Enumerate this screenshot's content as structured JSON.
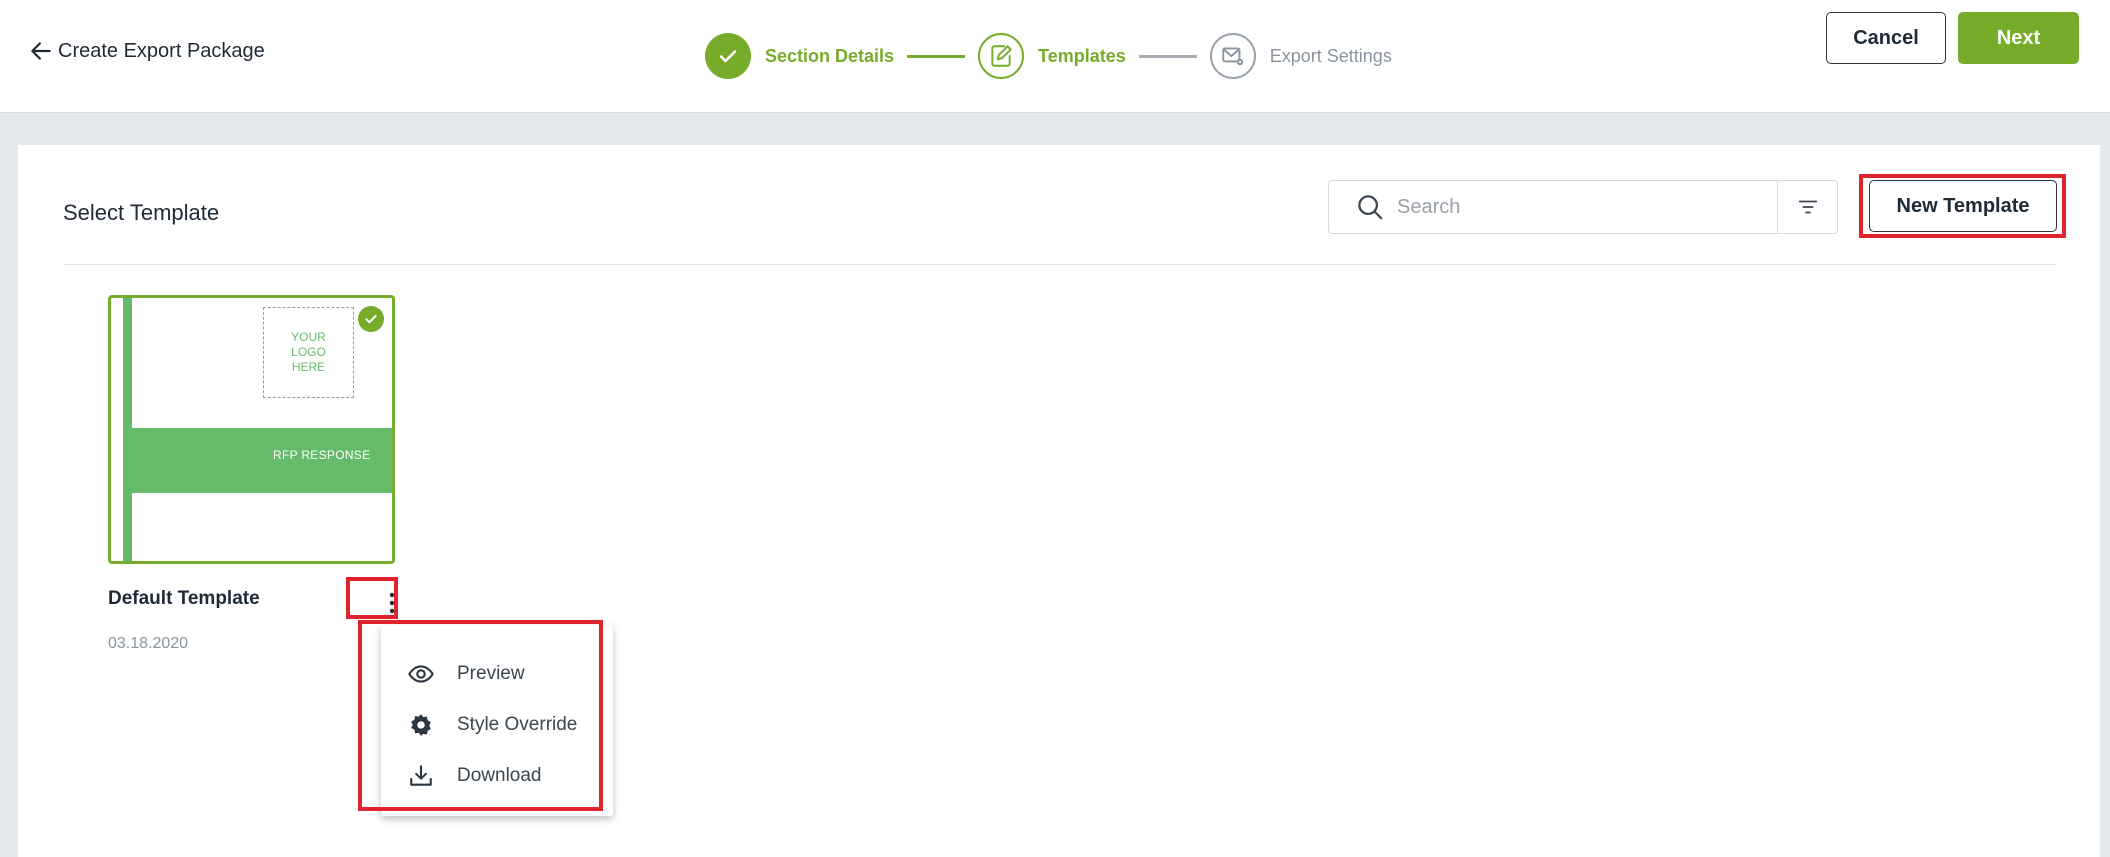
{
  "header": {
    "title": "Create Export Package",
    "cancel_label": "Cancel",
    "next_label": "Next"
  },
  "stepper": {
    "steps": [
      {
        "label": "Section Details",
        "state": "done"
      },
      {
        "label": "Templates",
        "state": "active"
      },
      {
        "label": "Export Settings",
        "state": "pending"
      }
    ]
  },
  "main": {
    "title": "Select Template",
    "search_placeholder": "Search",
    "new_template_label": "New Template"
  },
  "template_card": {
    "logo_text": "YOUR LOGO HERE",
    "band_text": "RFP RESPONSE",
    "name": "Default Template",
    "date": "03.18.2020",
    "selected": true
  },
  "context_menu": {
    "items": [
      {
        "label": "Preview",
        "icon": "eye-icon"
      },
      {
        "label": "Style Override",
        "icon": "gear-icon"
      },
      {
        "label": "Download",
        "icon": "download-icon"
      }
    ]
  },
  "colors": {
    "accent": "#77ab2a",
    "template_green": "#66bb6a",
    "highlight": "#e0242e"
  }
}
